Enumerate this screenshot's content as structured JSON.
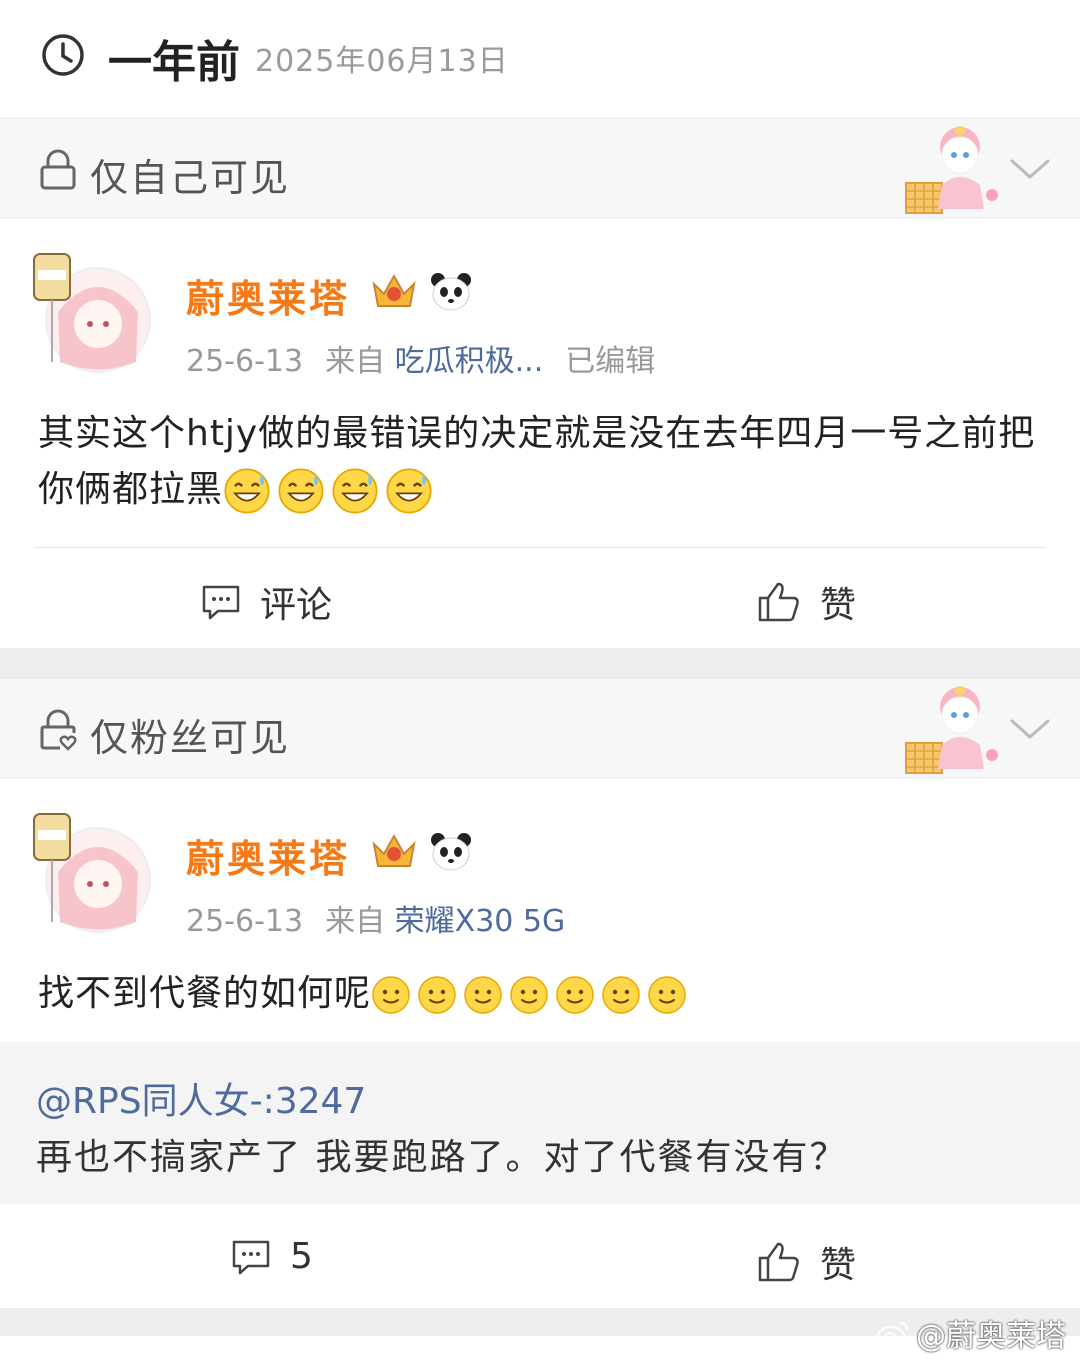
{
  "header": {
    "relative_time": "一年前",
    "date": "2025年06月13日"
  },
  "posts": [
    {
      "visibility": "仅自己可见",
      "username": "蔚奥莱塔",
      "date": "25-6-13",
      "source_prefix": "来自",
      "source": "吃瓜积极...",
      "edited": "已编辑",
      "text": "其实这个htjy做的最错误的决定就是没在去年四月一号之前把你俩都拉黑",
      "emojis": [
        "sweat-smile-emoji",
        "sweat-smile-emoji",
        "sweat-smile-emoji",
        "sweat-smile-emoji"
      ],
      "comment_label": "评论",
      "like_label": "赞"
    },
    {
      "visibility": "仅粉丝可见",
      "username": "蔚奥莱塔",
      "date": "25-6-13",
      "source_prefix": "来自",
      "source": "荣耀X30 5G",
      "text": "找不到代餐的如何呢",
      "emojis": [
        "slight-smile-emoji",
        "slight-smile-emoji",
        "slight-smile-emoji",
        "slight-smile-emoji",
        "slight-smile-emoji",
        "slight-smile-emoji",
        "slight-smile-emoji"
      ],
      "quote": {
        "user": "@RPS同人女-:3247",
        "text": "再也不搞家产了 我要跑路了。对了代餐有没有？"
      },
      "comment_count": "5",
      "like_label": "赞"
    }
  ],
  "watermark": "@蔚奥莱塔",
  "colors": {
    "username": "#f57a16",
    "link": "#4f6a9c",
    "separator": "#eeeeee"
  }
}
